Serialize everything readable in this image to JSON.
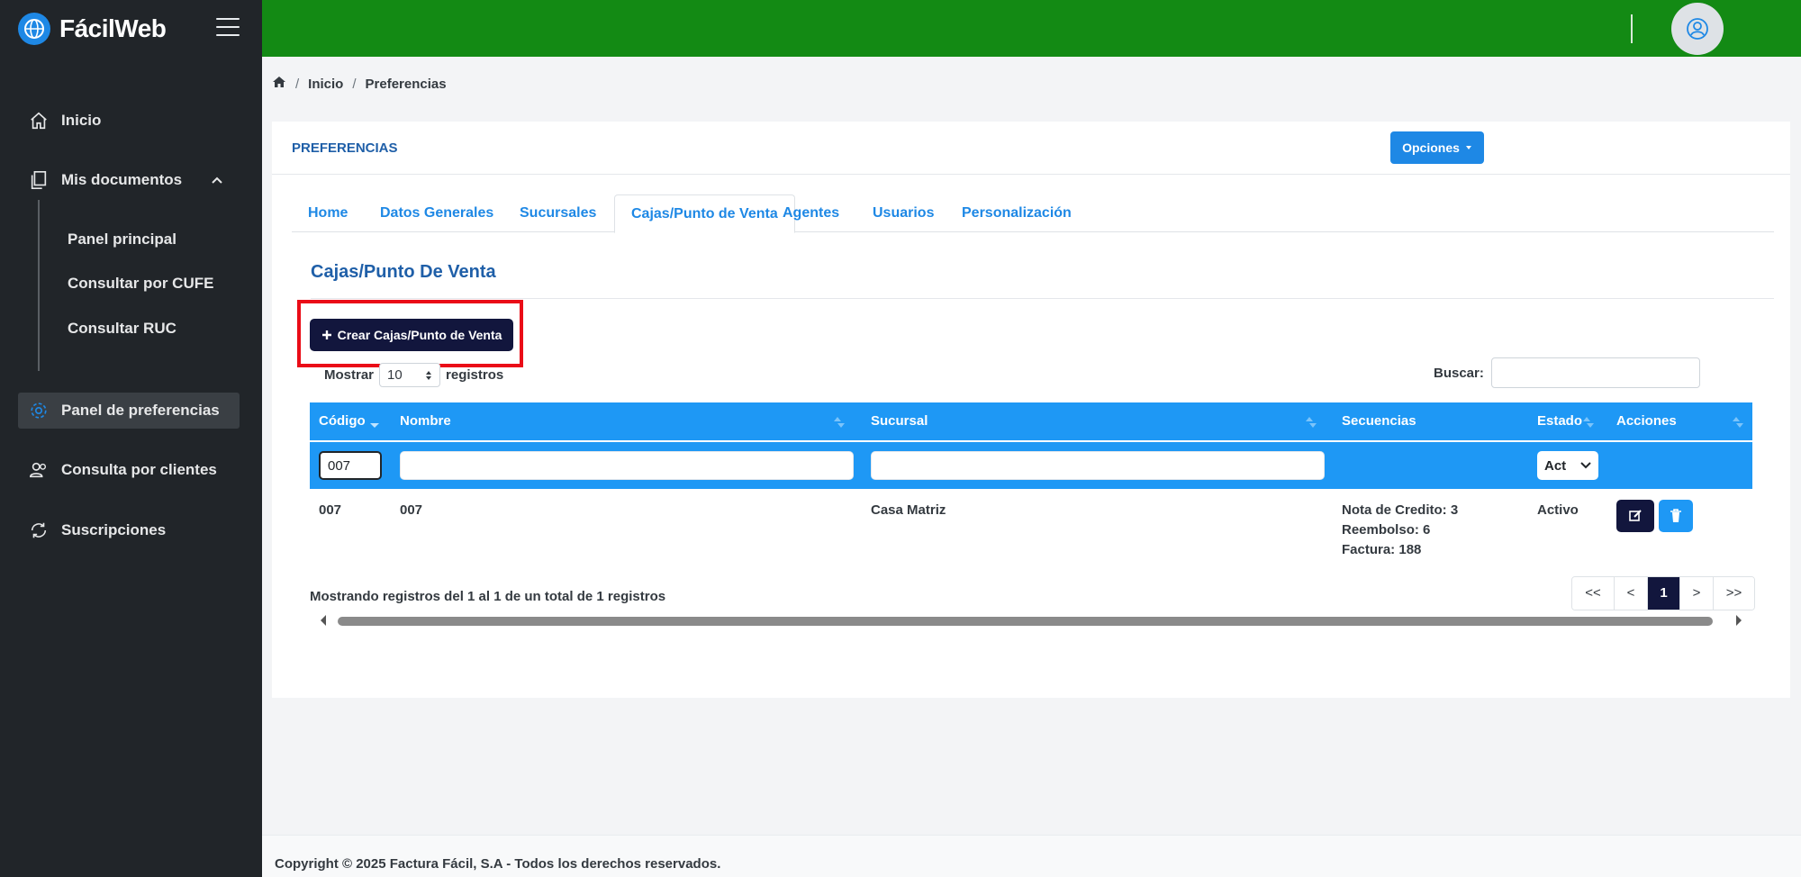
{
  "app": {
    "name": "FácilWeb"
  },
  "sidebar": {
    "items": [
      {
        "label": "Inicio",
        "icon": "home-icon"
      },
      {
        "label": "Mis documentos",
        "icon": "documents-icon"
      },
      {
        "label": "Panel de preferencias",
        "icon": "gear-icon"
      },
      {
        "label": "Consulta por clientes",
        "icon": "users-icon"
      },
      {
        "label": "Suscripciones",
        "icon": "refresh-icon"
      }
    ],
    "submenu": [
      "Panel principal",
      "Consultar por CUFE",
      "Consultar RUC"
    ]
  },
  "breadcrumb": {
    "home": "Inicio",
    "current": "Preferencias"
  },
  "card": {
    "title": "PREFERENCIAS"
  },
  "tabs": [
    "Home",
    "Datos Generales",
    "Sucursales",
    "Cajas/Punto de Venta",
    "Agentes",
    "Usuarios",
    "Personalización"
  ],
  "section": {
    "title": "Cajas/Punto De Venta",
    "options_label": "Opciones",
    "create_label": "Crear Cajas/Punto de Venta"
  },
  "table_controls": {
    "show_label": "Mostrar",
    "show_value": "10",
    "records_label": "registros",
    "search_label": "Buscar:"
  },
  "table": {
    "columns": [
      "Código",
      "Nombre",
      "Sucursal",
      "Secuencias",
      "Estado",
      "Acciones"
    ],
    "filters": {
      "codigo": "007",
      "estado": "Act"
    },
    "rows": [
      {
        "codigo": "007",
        "nombre": "007",
        "sucursal": "Casa Matriz",
        "secuencias": [
          "Nota de Credito: 3",
          "Reembolso: 6",
          "Factura: 188"
        ],
        "estado": "Activo"
      }
    ]
  },
  "info": "Mostrando registros del 1 al 1 de un total de 1 registros",
  "pager": {
    "first": "<<",
    "prev": "<",
    "current": "1",
    "next": ">",
    "last": ">>"
  },
  "footer": "Copyright © 2025 Factura Fácil, S.A - Todos los derechos reservados.",
  "colors": {
    "topbar": "#138a14",
    "sidebar": "#212529",
    "accent": "#1e88e5",
    "dark_button": "#12163d",
    "highlight": "#ea0c17"
  }
}
